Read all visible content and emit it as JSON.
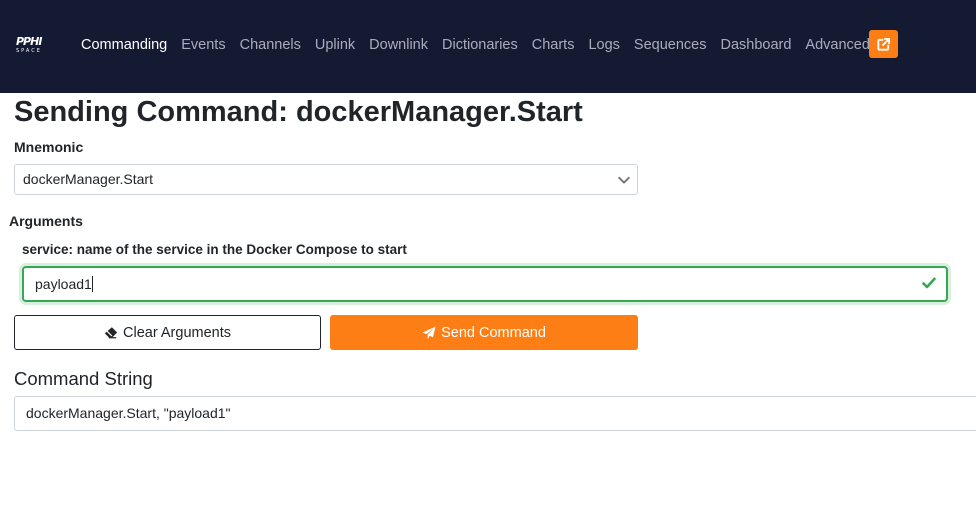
{
  "nav": {
    "brand": "PPHI",
    "brand_sub": "SPACE",
    "items": [
      {
        "label": "Commanding",
        "active": true
      },
      {
        "label": "Events"
      },
      {
        "label": "Channels"
      },
      {
        "label": "Uplink"
      },
      {
        "label": "Downlink"
      },
      {
        "label": "Dictionaries"
      },
      {
        "label": "Charts"
      },
      {
        "label": "Logs"
      },
      {
        "label": "Sequences"
      },
      {
        "label": "Dashboard"
      },
      {
        "label": "Advanced"
      }
    ],
    "external_icon": "external-link-icon"
  },
  "page": {
    "title": "Sending Command: dockerManager.Start"
  },
  "mnemonic": {
    "label": "Mnemonic",
    "selected": "dockerManager.Start"
  },
  "arguments": {
    "label": "Arguments",
    "items": [
      {
        "label": "service: name of the service in the Docker Compose to start",
        "value": "payload1"
      }
    ]
  },
  "buttons": {
    "clear_label": "Clear Arguments",
    "send_label": "Send Command"
  },
  "command_string": {
    "label": "Command String",
    "value": "dockerManager.Start, \"payload1\""
  },
  "colors": {
    "navbar": "#151a33",
    "accent": "#fd7e14",
    "valid": "#34a853"
  }
}
